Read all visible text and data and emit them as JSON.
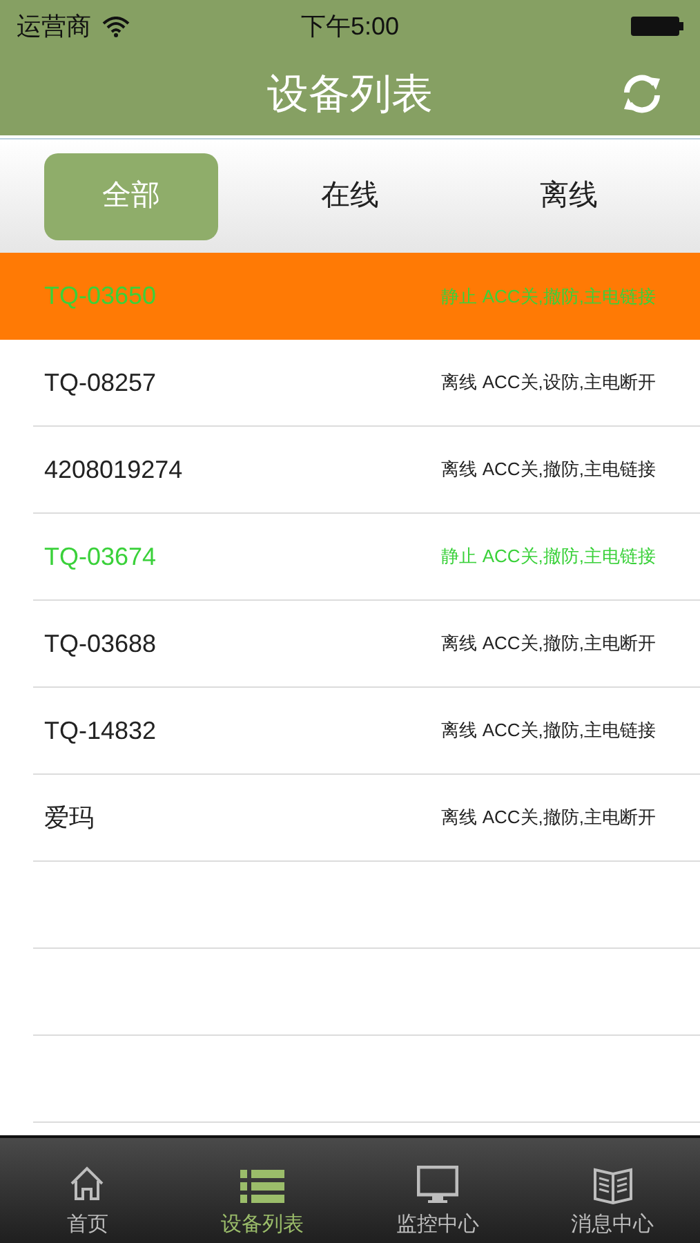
{
  "status_bar": {
    "carrier": "运营商",
    "time": "下午5:00"
  },
  "nav": {
    "title": "设备列表"
  },
  "filters": [
    {
      "label": "全部",
      "selected": true
    },
    {
      "label": "在线",
      "selected": false
    },
    {
      "label": "离线",
      "selected": false
    }
  ],
  "devices": [
    {
      "name": "TQ-03650",
      "info": "静止 ACC关,撤防,主电链接",
      "color": "#3ad13a",
      "selected": true
    },
    {
      "name": "TQ-08257",
      "info": "离线 ACC关,设防,主电断开",
      "color": "#222222",
      "selected": false
    },
    {
      "name": "4208019274",
      "info": "离线 ACC关,撤防,主电链接",
      "color": "#222222",
      "selected": false
    },
    {
      "name": "TQ-03674",
      "info": "静止 ACC关,撤防,主电链接",
      "color": "#3ad13a",
      "selected": false
    },
    {
      "name": "TQ-03688",
      "info": "离线 ACC关,撤防,主电断开",
      "color": "#222222",
      "selected": false
    },
    {
      "name": "TQ-14832",
      "info": "离线 ACC关,撤防,主电链接",
      "color": "#222222",
      "selected": false
    },
    {
      "name": "爱玛",
      "info": "离线 ACC关,撤防,主电断开",
      "color": "#222222",
      "selected": false
    }
  ],
  "tabs": [
    {
      "label": "首页",
      "kind": "home",
      "selected": false
    },
    {
      "label": "设备列表",
      "kind": "list",
      "selected": true
    },
    {
      "label": "监控中心",
      "kind": "monitor",
      "selected": false
    },
    {
      "label": "消息中心",
      "kind": "book",
      "selected": false
    }
  ]
}
